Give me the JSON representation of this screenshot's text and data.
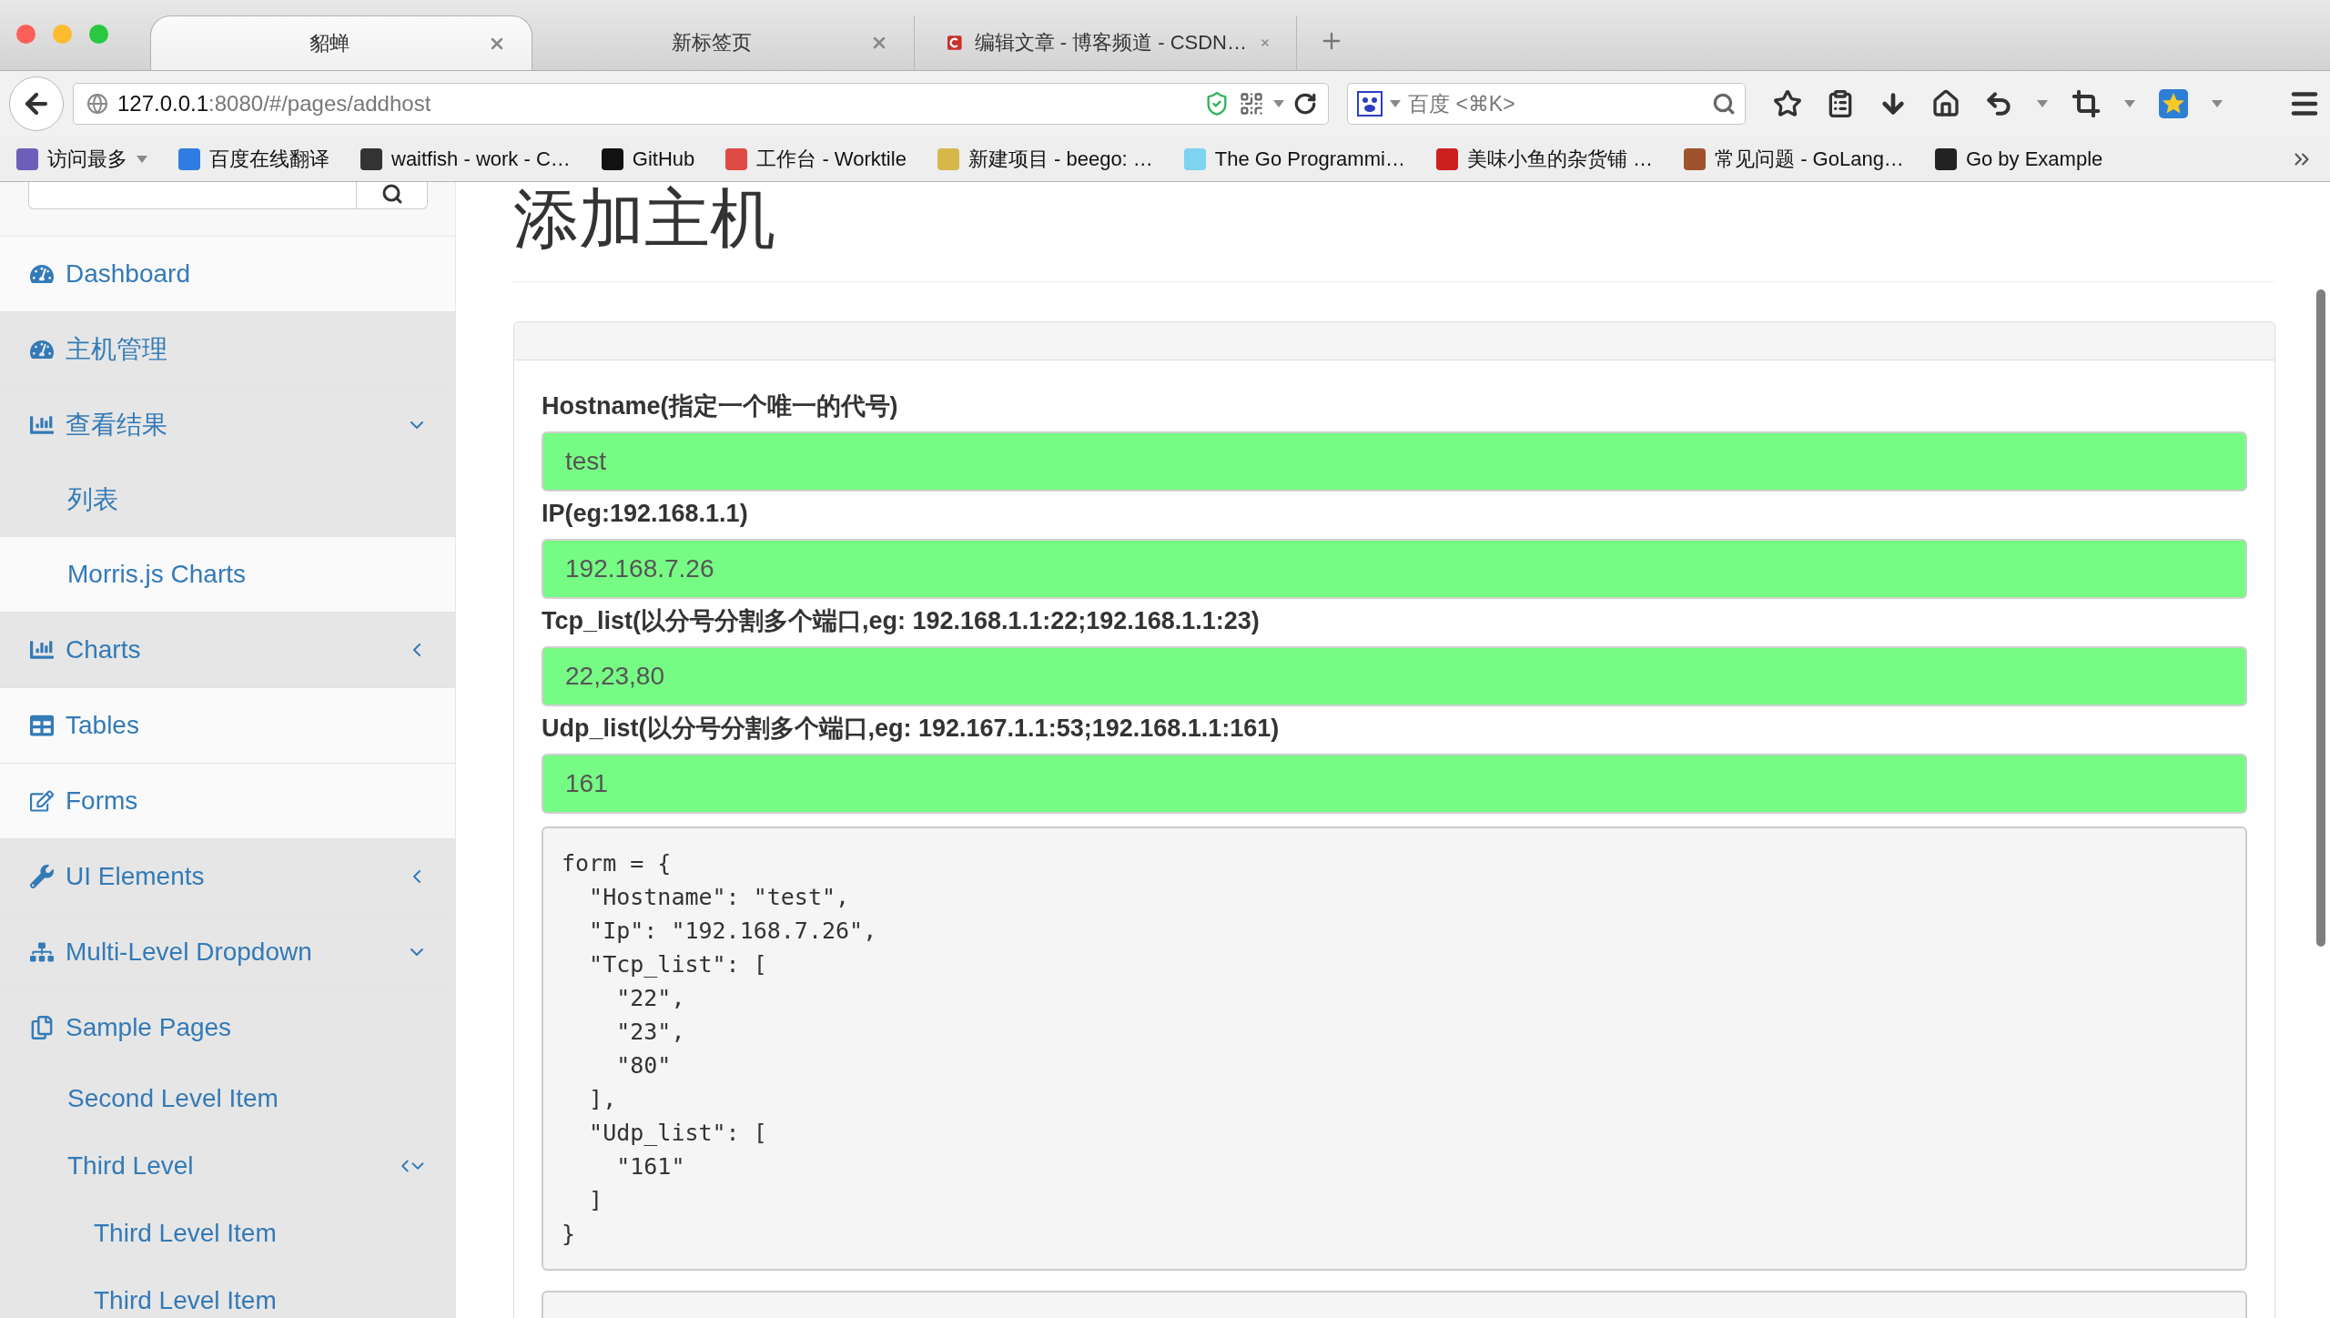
{
  "window": {
    "tabs": [
      {
        "title": "貂蝉",
        "selected": true,
        "has_icon": false
      },
      {
        "title": "新标签页",
        "selected": false,
        "has_icon": false
      },
      {
        "title": "编辑文章 - 博客频道 - CSDN…",
        "selected": false,
        "has_icon": true
      }
    ]
  },
  "toolbar": {
    "url_host": "127.0.0.1",
    "url_rest": ":8080/#/pages/addhost",
    "search_placeholder": "百度 <⌘K>"
  },
  "bookmarks": [
    {
      "label": "访问最多",
      "color": "#6d5fb8",
      "menu": true
    },
    {
      "label": "百度在线翻译",
      "color": "#2f7de1",
      "menu": false
    },
    {
      "label": "waitfish - work - C…",
      "color": "#333333",
      "menu": false
    },
    {
      "label": "GitHub",
      "color": "#111111",
      "menu": false
    },
    {
      "label": "工作台 - Worktile",
      "color": "#e04a45",
      "menu": false
    },
    {
      "label": "新建项目 - beego: …",
      "color": "#d6b84a",
      "menu": false
    },
    {
      "label": "The Go Programmi…",
      "color": "#7dd3f0",
      "menu": false
    },
    {
      "label": "美味小鱼的杂货铺 …",
      "color": "#cc1f1f",
      "menu": false
    },
    {
      "label": "常见问题 - GoLang…",
      "color": "#a0522d",
      "menu": false
    },
    {
      "label": "Go by Example",
      "color": "#222222",
      "menu": false
    }
  ],
  "sidebar": {
    "items": [
      {
        "label": "Dashboard",
        "active": false,
        "kind": "link"
      },
      {
        "label": "主机管理",
        "active": true,
        "kind": "link"
      },
      {
        "label": "查看结果",
        "active": true,
        "kind": "open",
        "children": [
          {
            "label": "列表",
            "active": true,
            "kind": "link"
          },
          {
            "label": "Morris.js Charts",
            "active": false,
            "kind": "link"
          }
        ]
      },
      {
        "label": "Charts",
        "active": true,
        "kind": "closed"
      },
      {
        "label": "Tables",
        "active": false,
        "kind": "link"
      },
      {
        "label": "Forms",
        "active": false,
        "kind": "link"
      },
      {
        "label": "UI Elements",
        "active": true,
        "kind": "closed"
      },
      {
        "label": "Multi-Level Dropdown",
        "active": true,
        "kind": "open"
      },
      {
        "label": "Sample Pages",
        "active": true,
        "kind": "link",
        "children": [
          {
            "label": "Second Level Item",
            "active": true,
            "kind": "link"
          },
          {
            "label": "Third Level",
            "active": true,
            "kind": "both",
            "children": [
              {
                "label": "Third Level Item",
                "active": true
              },
              {
                "label": "Third Level Item",
                "active": true
              }
            ]
          }
        ]
      }
    ]
  },
  "page": {
    "title": "添加主机",
    "fields": [
      {
        "label": "Hostname(指定一个唯一的代号)",
        "value": "test"
      },
      {
        "label": "IP(eg:192.168.1.1)",
        "value": "192.168.7.26"
      },
      {
        "label": "Tcp_list(以分号分割多个端口,eg: 192.168.1.1:22;192.168.1.1:23)",
        "value": "22,23,80"
      },
      {
        "label": "Udp_list(以分号分割多个端口,eg: 192.167.1.1:53;192.168.1.1:161)",
        "value": "161"
      }
    ],
    "code": "form = {\n  \"Hostname\": \"test\",\n  \"Ip\": \"192.168.7.26\",\n  \"Tcp_list\": [\n    \"22\",\n    \"23\",\n    \"80\"\n  ],\n  \"Udp_list\": [\n    \"161\"\n  ]\n}"
  }
}
